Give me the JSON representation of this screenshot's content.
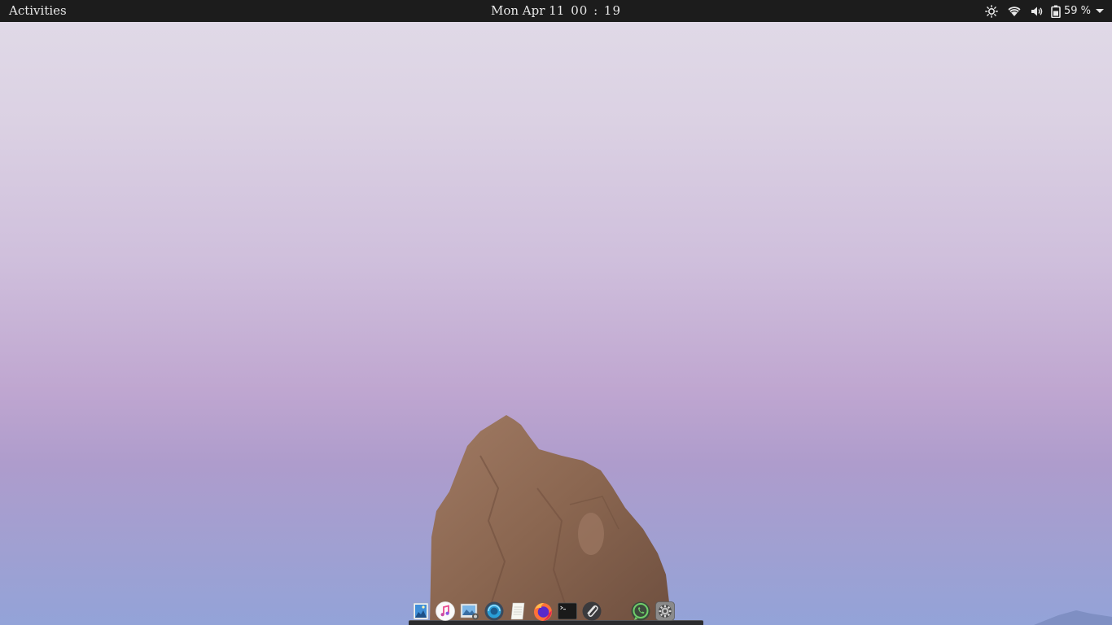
{
  "topbar": {
    "activities_label": "Activities",
    "clock": {
      "day": "Mon Apr 11",
      "time": "00 : 19"
    },
    "tray": {
      "icons": [
        "brightness-icon",
        "wifi-icon",
        "volume-icon",
        "battery-icon"
      ],
      "battery_percent": "59 %"
    }
  },
  "dock": {
    "apps": [
      {
        "name": "image-viewer",
        "icon": "image-viewer-icon"
      },
      {
        "name": "music",
        "icon": "music-icon"
      },
      {
        "name": "photos",
        "icon": "photos-icon"
      },
      {
        "name": "browser",
        "icon": "browser-icon"
      },
      {
        "name": "text-editor",
        "icon": "text-editor-icon"
      },
      {
        "name": "firefox",
        "icon": "firefox-icon"
      },
      {
        "name": "terminal",
        "icon": "terminal-icon"
      },
      {
        "name": "attachments",
        "icon": "paperclip-icon"
      },
      {
        "name": "whatsapp",
        "icon": "whatsapp-icon"
      },
      {
        "name": "system-settings",
        "icon": "settings-icon"
      }
    ]
  },
  "colors": {
    "topbar_bg": "#1c1c1c",
    "topbar_text": "#e8e8e8",
    "sky_top": "#e1dbe8",
    "sky_mid": "#bfa6d0",
    "sky_bottom": "#93a3d8",
    "rock": "#8a6650"
  }
}
